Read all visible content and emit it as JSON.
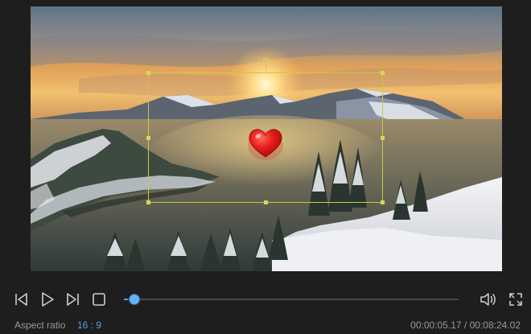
{
  "player": {
    "progress": 0.012,
    "icons": {
      "prev_frame": "previous-frame-icon",
      "play": "play-icon",
      "next_frame": "next-frame-icon",
      "stop": "stop-icon",
      "volume": "volume-icon",
      "fullscreen": "fullscreen-icon"
    }
  },
  "preview": {
    "sticker": "heart-icon",
    "sticker_color": "#e02020"
  },
  "status": {
    "aspect_label": "Aspect ratio",
    "aspect_value": "16 : 9",
    "current_time": "00:00:05.17",
    "separator": " / ",
    "total_time": "00:08:24.02"
  },
  "colors": {
    "accent": "#5aa0e0",
    "selection": "#c9c94a",
    "background": "#1e1e1f"
  }
}
